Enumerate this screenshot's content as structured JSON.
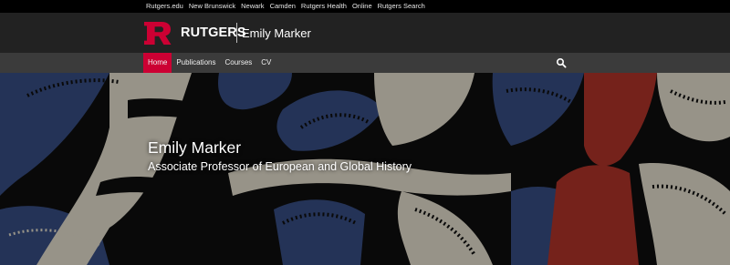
{
  "utility_links": [
    "Rutgers.edu",
    "New Brunswick",
    "Newark",
    "Camden",
    "Rutgers Health",
    "Online",
    "Rutgers Search"
  ],
  "brand": {
    "logo_icon": "rutgers-r-logo-icon",
    "wordmark": "RUTGERS",
    "site_name": "Emily Marker",
    "logo_color": "#cc0033"
  },
  "nav": {
    "items": [
      "Home",
      "Publications",
      "Courses",
      "CV"
    ],
    "active": "Home",
    "search_icon": "search-icon"
  },
  "hero": {
    "title": "Emily Marker",
    "subtitle": "Associate Professor of European and Global History",
    "background": "decorative-textile-pattern"
  },
  "colors": {
    "accent": "#cc0033",
    "topbar": "#000000",
    "brandbar": "#222222",
    "navbar": "#3b3b3b",
    "pattern_blue": "#2d3f6b",
    "pattern_cream": "#b9b4a6",
    "pattern_red": "#8f2a22"
  }
}
